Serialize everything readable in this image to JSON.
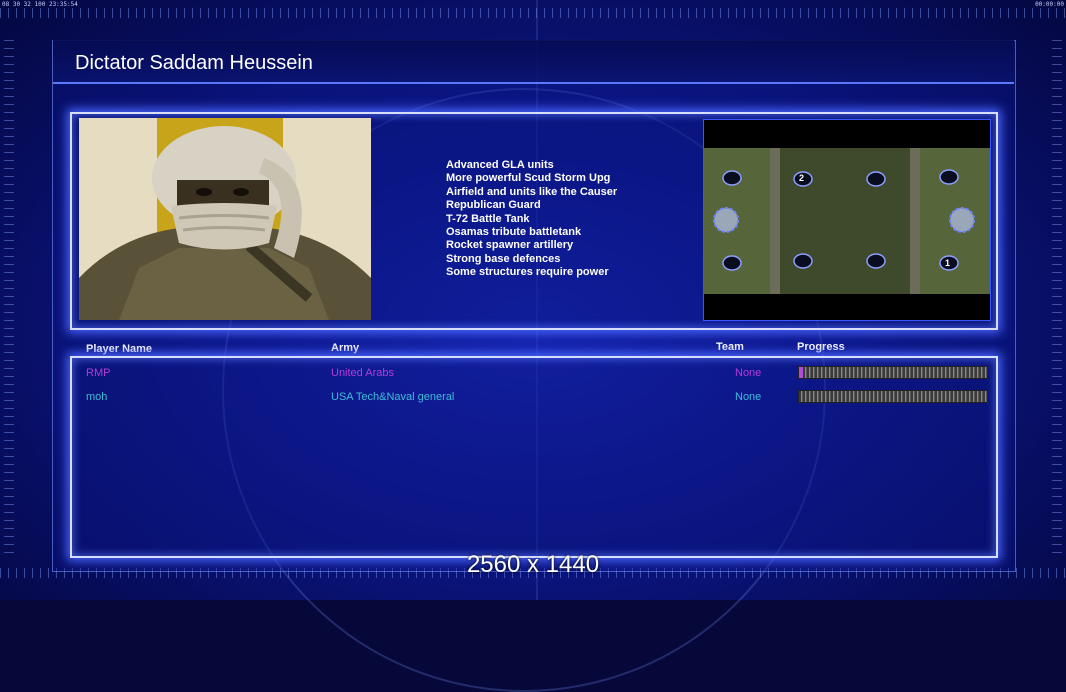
{
  "hud": {
    "left_text": "08 30 32 100 23:35:54",
    "right_text": "00:00:00"
  },
  "general": {
    "name": "Dictator Saddam Heussein",
    "features": [
      "Advanced GLA units",
      "More powerful Scud Storm Upg",
      "Airfield and units like the Causer",
      "Republican Guard",
      "T-72 Battle Tank",
      "Osamas tribute battletank",
      "Rocket spawner artillery",
      "Strong base defences",
      "Some structures require power"
    ]
  },
  "minimap": {
    "start_labels": [
      "2",
      "1"
    ]
  },
  "players_table": {
    "headers": {
      "player_name": "Player Name",
      "army": "Army",
      "team": "Team",
      "progress": "Progress"
    },
    "rows": [
      {
        "name": "RMP",
        "army": "United Arabs",
        "team": "None",
        "color": "#b43cd6",
        "progress": 0.02
      },
      {
        "name": "moh",
        "army": "USA Tech&Naval general",
        "team": "None",
        "color": "#3fbcd8",
        "progress": 0.0
      }
    ]
  },
  "footer": {
    "resolution": "2560 x 1440"
  },
  "colors": {
    "frame_glow": "#4a66ff",
    "background": "#0f1a92"
  }
}
